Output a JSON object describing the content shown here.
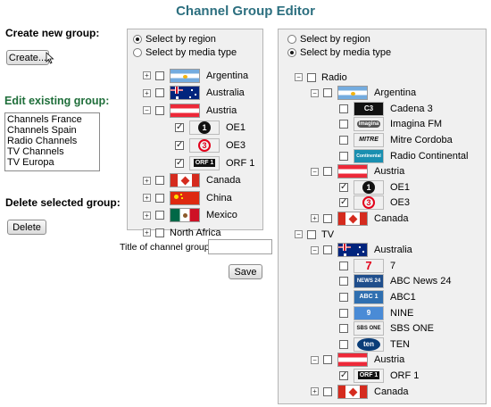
{
  "title": "Channel Group Editor",
  "create": {
    "heading": "Create new group:",
    "button": "Create..."
  },
  "edit": {
    "heading": "Edit existing group:",
    "groups": [
      "Channels France",
      "Channels Spain",
      "Radio Channels",
      "TV Channels",
      "TV Europa"
    ]
  },
  "delete": {
    "heading": "Delete selected group:",
    "button": "Delete"
  },
  "left_panel": {
    "radio_region": "Select by region",
    "radio_media": "Select by media type",
    "selected": "region",
    "items": [
      {
        "label": "Argentina",
        "flag": "argentina",
        "indent": 0,
        "expander": "+",
        "checked": false
      },
      {
        "label": "Australia",
        "flag": "australia",
        "indent": 0,
        "expander": "+",
        "checked": false
      },
      {
        "label": "Austria",
        "flag": "austria",
        "indent": 0,
        "expander": "-",
        "checked": false
      },
      {
        "label": "OE1",
        "logo": "oe1",
        "indent": 1,
        "checked": true
      },
      {
        "label": "OE3",
        "logo": "oe3",
        "indent": 1,
        "checked": true
      },
      {
        "label": "ORF 1",
        "logo": "orf1",
        "indent": 1,
        "checked": true
      },
      {
        "label": "Canada",
        "flag": "canada",
        "indent": 0,
        "expander": "+",
        "checked": false
      },
      {
        "label": "China",
        "flag": "china",
        "indent": 0,
        "expander": "+",
        "checked": false
      },
      {
        "label": "Mexico",
        "flag": "mexico",
        "indent": 0,
        "expander": "+",
        "checked": false
      },
      {
        "label": "North Africa",
        "indent": 0,
        "expander": "+",
        "checked": false
      }
    ]
  },
  "title_field": {
    "label": "Title of channel group:",
    "value": ""
  },
  "save_button": "Save",
  "right_panel": {
    "radio_region": "Select by region",
    "radio_media": "Select by media type",
    "selected": "media",
    "items": [
      {
        "label": "Radio",
        "indent": 0,
        "expander": "-",
        "checked": false
      },
      {
        "label": "Argentina",
        "flag": "argentina",
        "indent": 1,
        "expander": "-",
        "checked": false
      },
      {
        "label": "Cadena 3",
        "logo": "cadena3",
        "indent": 2,
        "checked": false
      },
      {
        "label": "Imagina FM",
        "logo": "imagina",
        "indent": 2,
        "checked": false
      },
      {
        "label": "Mitre Cordoba",
        "logo": "mitre",
        "indent": 2,
        "checked": false
      },
      {
        "label": "Radio Continental",
        "logo": "continental",
        "indent": 2,
        "checked": false
      },
      {
        "label": "Austria",
        "flag": "austria",
        "indent": 1,
        "expander": "-",
        "checked": false
      },
      {
        "label": "OE1",
        "logo": "oe1",
        "indent": 2,
        "checked": true
      },
      {
        "label": "OE3",
        "logo": "oe3",
        "indent": 2,
        "checked": true
      },
      {
        "label": "Canada",
        "flag": "canada",
        "indent": 1,
        "expander": "+",
        "checked": false
      },
      {
        "label": "TV",
        "indent": 0,
        "expander": "-",
        "checked": false
      },
      {
        "label": "Australia",
        "flag": "australia",
        "indent": 1,
        "expander": "-",
        "checked": false
      },
      {
        "label": "7",
        "logo": "seven",
        "indent": 2,
        "checked": false
      },
      {
        "label": "ABC News 24",
        "logo": "abcnews",
        "indent": 2,
        "checked": false
      },
      {
        "label": "ABC1",
        "logo": "abc1",
        "indent": 2,
        "checked": false
      },
      {
        "label": "NINE",
        "logo": "nine",
        "indent": 2,
        "checked": false
      },
      {
        "label": "SBS ONE",
        "logo": "sbs",
        "indent": 2,
        "checked": false
      },
      {
        "label": "TEN",
        "logo": "ten",
        "indent": 2,
        "checked": false
      },
      {
        "label": "Austria",
        "flag": "austria",
        "indent": 1,
        "expander": "-",
        "checked": false
      },
      {
        "label": "ORF 1",
        "logo": "orf1",
        "indent": 2,
        "checked": true
      },
      {
        "label": "Canada",
        "flag": "canada",
        "indent": 1,
        "expander": "+",
        "checked": false
      }
    ]
  },
  "logo_text": {
    "oe1": "1",
    "oe3": "3",
    "orf1": "ORF 1",
    "cadena3": "C3",
    "imagina": "imagina",
    "mitre": "MITRE",
    "continental": "Continental",
    "seven": "7",
    "abcnews": "NEWS 24",
    "abc1": "ABC 1",
    "nine": "9",
    "sbs": "SBS ONE",
    "ten": "ten"
  },
  "colors": {
    "title": "#2c6f7f",
    "edit_heading": "#1f6e3a",
    "panel_bg": "#f0f0f0"
  }
}
